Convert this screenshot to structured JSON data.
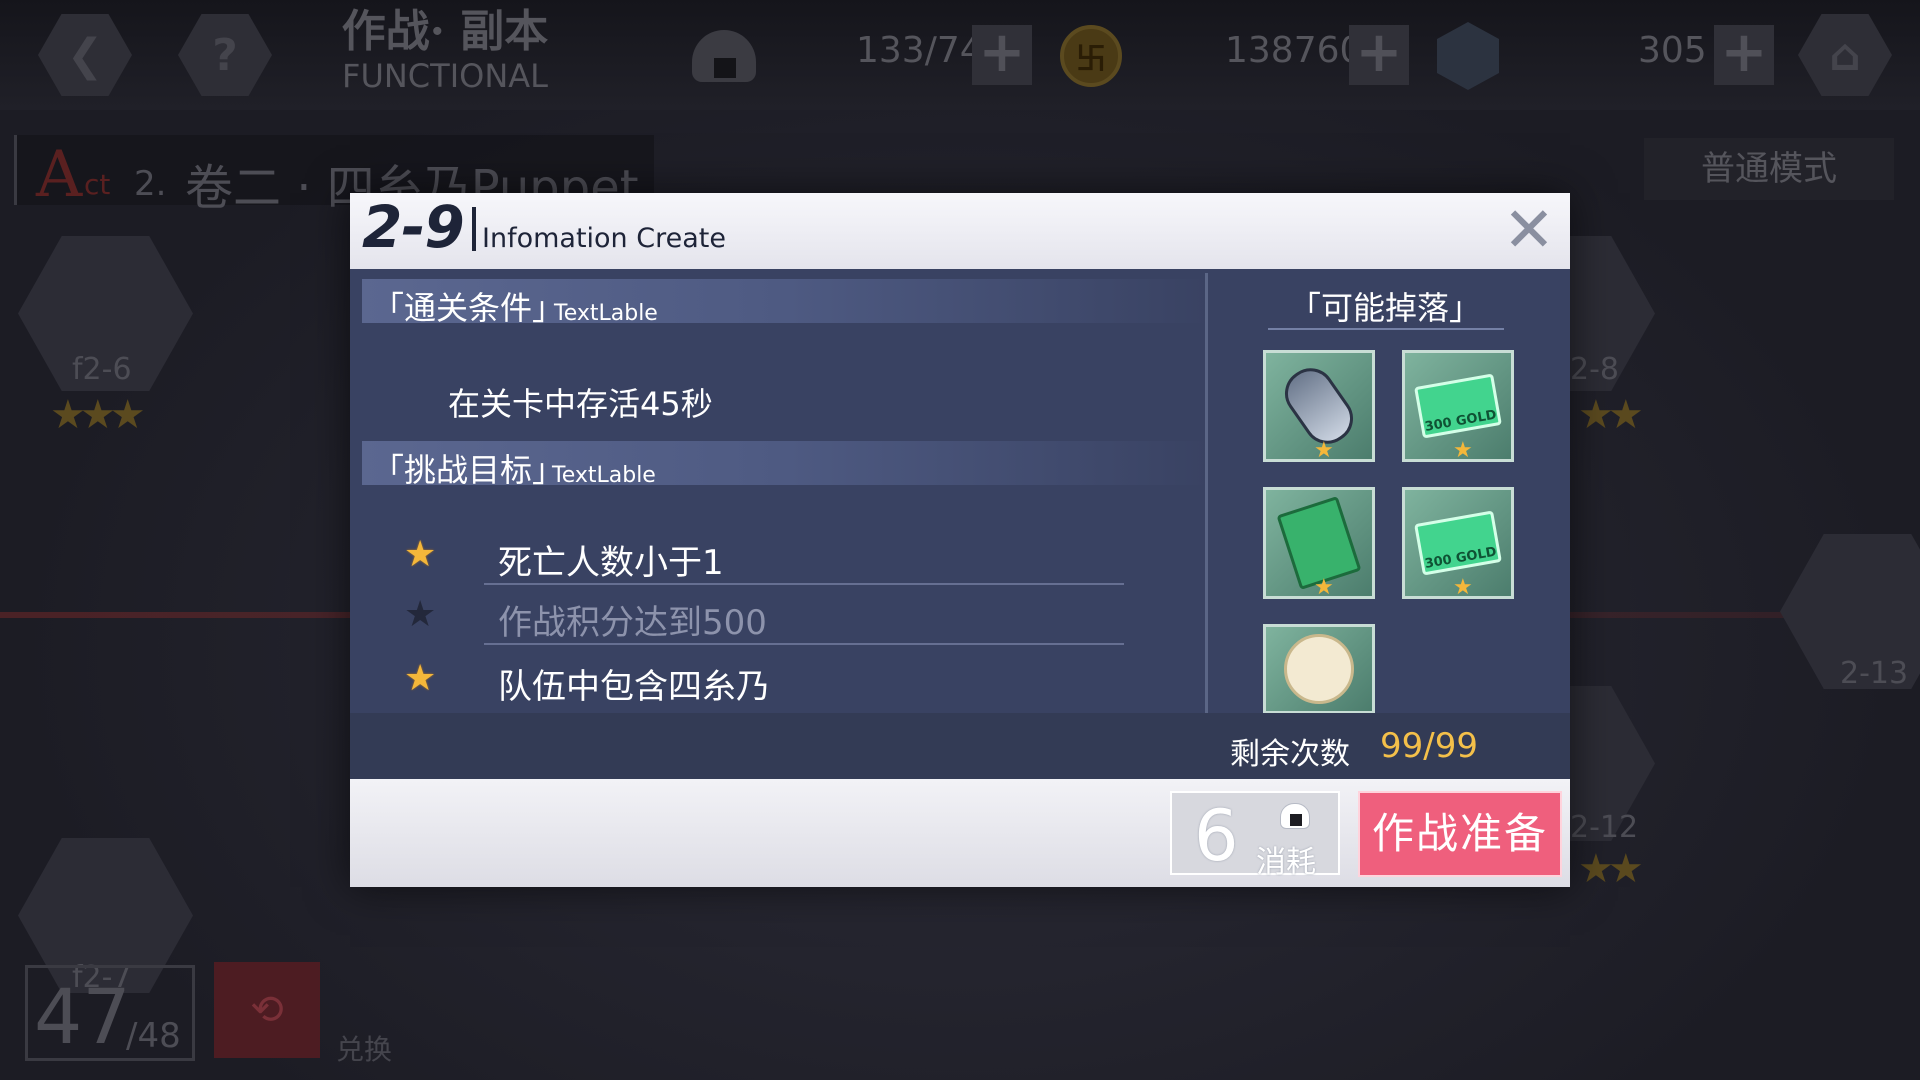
{
  "topbar": {
    "title_cn": "作战· 副本",
    "title_en": "FUNCTIONAL",
    "stamina": "133/74",
    "gold": "138760",
    "gems": "305",
    "coin_symbol": "卐"
  },
  "act": {
    "a": "A",
    "ct": "ct",
    "num": "2.",
    "name": "卷二 · 四糸乃Puppet",
    "mode": "普通模式"
  },
  "background_stages": [
    {
      "label": "f2-6"
    },
    {
      "label": "2-8"
    },
    {
      "label": "2-13"
    },
    {
      "label": "f2-7"
    },
    {
      "label": "2-12"
    }
  ],
  "bottom_left": {
    "count": "47",
    "total": "/48",
    "exchange_label": "兑换"
  },
  "modal": {
    "stage_code": "2-9",
    "stage_sub": "Infomation Create",
    "clear_title": "「通关条件」",
    "clear_sub": "TextLable",
    "clear_condition": "在关卡中存活45秒",
    "goal_title": "「挑战目标」",
    "goal_sub": "TextLable",
    "goals": [
      {
        "text": "死亡人数小于1",
        "achieved": true
      },
      {
        "text": "作战积分达到500",
        "achieved": false
      },
      {
        "text": "队伍中包含四糸乃",
        "achieved": true
      }
    ],
    "drops_title": "「可能掉落」",
    "drops": [
      {
        "icon": "capsule-icon"
      },
      {
        "icon": "gold-ticket-icon",
        "text": "300 GOLD"
      },
      {
        "icon": "green-book-icon"
      },
      {
        "icon": "gold-ticket-icon",
        "text": "300 GOLD"
      },
      {
        "icon": "bunny-doll-icon"
      }
    ],
    "remaining_label": "剩余次数",
    "remaining_value": "99/99",
    "cost_value": "6",
    "cost_label": "消耗",
    "battle_button": "作战准备"
  },
  "colors": {
    "modal_body": "#394262",
    "accent_pink": "#ef5f7d",
    "star_gold": "#f4b73a",
    "remaining_yellow": "#f4c04a"
  }
}
